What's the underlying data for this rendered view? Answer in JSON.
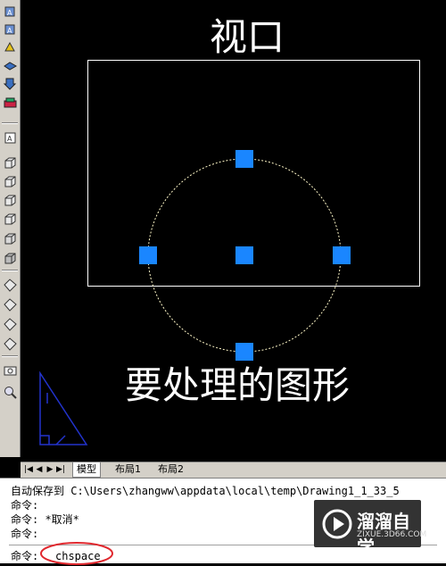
{
  "canvas": {
    "viewport_label": "视口",
    "shape_label": "要处理的图形"
  },
  "layout_tabs": [
    {
      "label": "模型"
    },
    {
      "label": "布局1"
    },
    {
      "label": "布局2"
    }
  ],
  "command_window": {
    "lines": [
      "自动保存到 C:\\Users\\zhangww\\appdata\\local\\temp\\Drawing1_1_33_5",
      "命令:",
      "命令: *取消*",
      "命令:"
    ],
    "prompt": "命令:",
    "input_value": "chspace"
  },
  "watermark": {
    "name": "溜溜自学",
    "url": "ZIXUE.3D66.COM"
  },
  "colors": {
    "grip": "#1a86ff",
    "highlight_ellipse": "#e0282e"
  }
}
